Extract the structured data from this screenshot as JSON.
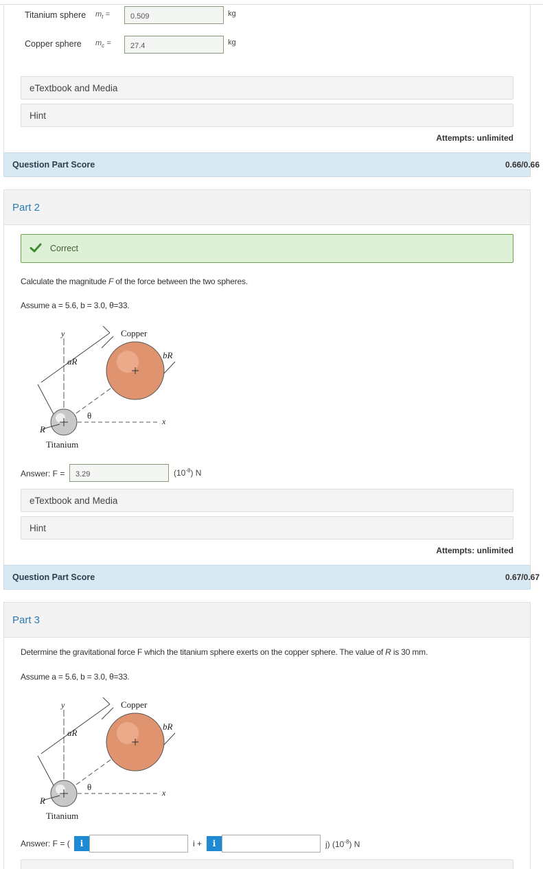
{
  "part1": {
    "titanium": {
      "label": "Titanium sphere",
      "sym": "m",
      "sub": "t",
      "eq": "=",
      "value": "0.509",
      "unit": "kg"
    },
    "copper": {
      "label": "Copper sphere",
      "sym": "m",
      "sub": "c",
      "eq": "=",
      "value": "27.4",
      "unit": "kg"
    },
    "etextbook": "eTextbook and Media",
    "hint": "Hint",
    "attempts": "Attempts: unlimited",
    "score_label": "Question Part Score",
    "score_value": "0.66/0.66"
  },
  "part2": {
    "title": "Part 2",
    "status": "Correct",
    "question_pre": "Calculate the magnitude ",
    "question_var": "F",
    "question_post": " of the force between the two spheres.",
    "assume": "Assume a = 5.6, b = 3.0, θ=33.",
    "answer_label": "Answer: F =",
    "answer_value": "3.29",
    "answer_unit": "(10",
    "answer_exp": "-8",
    "answer_unit_end": ") N",
    "etextbook": "eTextbook and Media",
    "hint": "Hint",
    "attempts": "Attempts: unlimited",
    "score_label": "Question Part Score",
    "score_value": "0.67/0.67"
  },
  "part3": {
    "title": "Part 3",
    "question_pre": "Determine the gravitational force F which the titanium sphere exerts on the copper sphere. The value of ",
    "question_var": "R",
    "question_post": " is 30 mm.",
    "assume": "Assume a = 5.6, b = 3.0, θ=33.",
    "answer_label": "Answer: F = (",
    "i_plus": "i +",
    "j_unit": "j) (10",
    "j_exp": "-8",
    "j_unit_end": ") N",
    "info_glyph": "i"
  },
  "figure": {
    "copper": "Copper",
    "titanium": "Titanium",
    "y": "y",
    "x": "x",
    "aR": "aR",
    "bR": "bR",
    "R": "R",
    "theta": "θ"
  },
  "colors": {
    "copper_fill": "#e0936f",
    "score_bar": "#d9e9f3",
    "correct_bg": "#dff0d8",
    "link_blue": "#2a7ab0",
    "info_blue": "#1f8ad3"
  }
}
